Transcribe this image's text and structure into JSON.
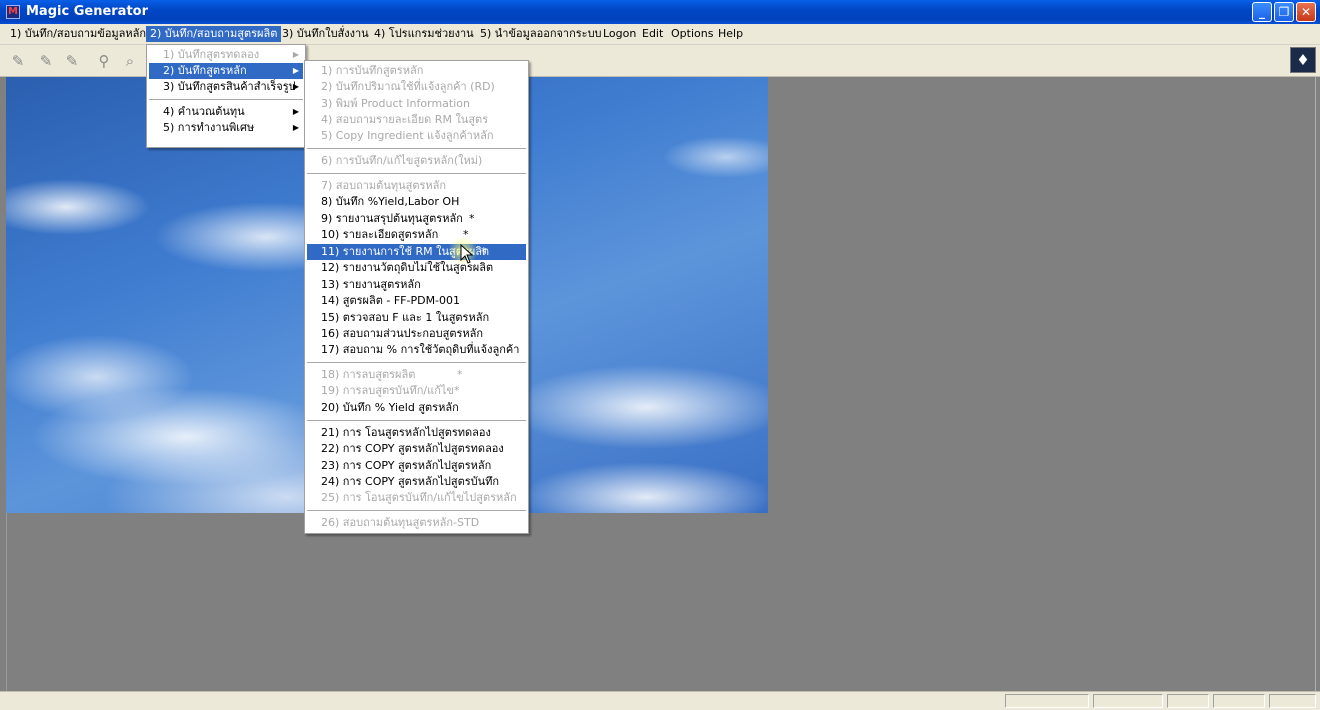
{
  "window": {
    "title": "Magic Generator",
    "icon": "app-m-icon"
  },
  "menubar": {
    "items": [
      {
        "label": "1) บันทึก/สอบถามข้อมูลหลัก"
      },
      {
        "label": "2) บันทึก/สอบถามสูตรผลิต",
        "active": true
      },
      {
        "label": "3) บันทึกใบสั่งงาน"
      },
      {
        "label": "4) โปรแกรมช่วยงาน"
      },
      {
        "label": "5) นำข้อมูลออกจากระบบ"
      },
      {
        "label": "Logon"
      },
      {
        "label": "Edit"
      },
      {
        "label": "Options"
      },
      {
        "label": "Help"
      }
    ]
  },
  "submenu1": {
    "items": [
      {
        "label": "1) บันทึกสูตรทดลอง",
        "disabled": true,
        "has_sub": true
      },
      {
        "label": "2) บันทึกสูตรหลัก",
        "selected": true,
        "has_sub": true
      },
      {
        "label": "3) บันทึกสูตรสินค้าสำเร็จรูป",
        "has_sub": true
      },
      {
        "label": "4) คำนวณต้นทุน",
        "has_sub": true
      },
      {
        "label": "5) การทำงานพิเศษ",
        "has_sub": true
      }
    ]
  },
  "submenu2": {
    "items": [
      {
        "label": "1) การบันทึกสูตรหลัก",
        "disabled": true
      },
      {
        "label": "2) บันทึกปริมาณใช้ที่แจ้งลูกค้า (RD)",
        "disabled": true
      },
      {
        "label": "3) พิมพ์ Product Information",
        "disabled": true
      },
      {
        "label": "4) สอบถามรายละเอียด RM ในสูตร",
        "disabled": true
      },
      {
        "label": "5) Copy Ingredient แจ้งลูกค้าหลัก",
        "disabled": true
      },
      {
        "label": "6) การบันทึก/แก้ไขสูตรหลัก(ใหม่)",
        "disabled": true
      },
      {
        "label": "7) สอบถามต้นทุนสูตรหลัก",
        "disabled": true
      },
      {
        "label": "8) บันทึก %Yield,Labor  OH"
      },
      {
        "label": "9) รายงานสรุปต้นทุนสูตรหลัก",
        "star": "*"
      },
      {
        "label": "10) รายละเอียดสูตรหลัก",
        "star": "*"
      },
      {
        "label": "11) รายงานการใช้ RM ในสูตรผลิต",
        "star": "*",
        "selected": true
      },
      {
        "label": "12) รายงานวัตถุดิบไม่ใช้ในสูตรผลิต"
      },
      {
        "label": "13) รายงานสูตรหลัก"
      },
      {
        "label": "14) สูตรผลิต - FF-PDM-001"
      },
      {
        "label": "15) ตรวจสอบ F และ 1 ในสูตรหลัก"
      },
      {
        "label": "16) สอบถามส่วนประกอบสูตรหลัก"
      },
      {
        "label": "17) สอบถาม % การใช้วัตถุดิบที่แจ้งลูกค้า"
      },
      {
        "label": "18) การลบสูตรผลิต",
        "star": "*",
        "disabled": true
      },
      {
        "label": "19) การลบสูตรบันทึก/แก้ไข*",
        "disabled": true
      },
      {
        "label": "20) บันทึก % Yield สูตรหลัก"
      },
      {
        "label": "21) การ โอนสูตรหลักไปสูตรทดลอง"
      },
      {
        "label": "22) การ COPY สูตรหลักไปสูตรทดลอง"
      },
      {
        "label": "23) การ COPY สูตรหลักไปสูตรหลัก"
      },
      {
        "label": "24) การ COPY สูตรหลักไปสูตรบันทึก"
      },
      {
        "label": "25) การ โอนสูตรบันทึก/แก้ไขไปสูตรหลัก",
        "disabled": true
      },
      {
        "label": "26) สอบถามต้นทุนสูตรหลัก-STD",
        "disabled": true
      }
    ]
  },
  "colors": {
    "titlebar": "#0047c6",
    "menu_highlight": "#316ac5",
    "background": "#808080",
    "face": "#ece9d8"
  }
}
